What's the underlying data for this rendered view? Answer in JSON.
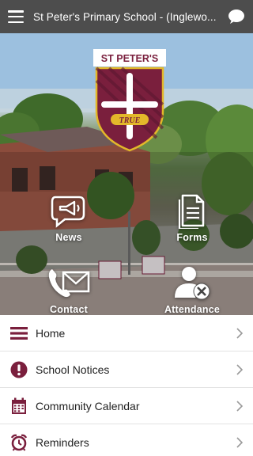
{
  "header": {
    "title": "St Peter's Primary School - (Inglewo...",
    "menu_icon": "hamburger-icon",
    "chat_icon": "chat-bubble-icon"
  },
  "crest": {
    "name": "ST PETER'S",
    "motto": "TRUE"
  },
  "tiles": [
    {
      "label": "News",
      "icon": "megaphone-icon"
    },
    {
      "label": "Forms",
      "icon": "document-icon"
    },
    {
      "label": "Contact",
      "icon": "phone-envelope-icon"
    },
    {
      "label": "Attendance",
      "icon": "person-cross-icon"
    }
  ],
  "menu": [
    {
      "label": "Home",
      "icon": "list-icon"
    },
    {
      "label": "School Notices",
      "icon": "alert-icon"
    },
    {
      "label": "Community Calendar",
      "icon": "calendar-icon"
    },
    {
      "label": "Reminders",
      "icon": "alarm-clock-icon"
    }
  ],
  "colors": {
    "header_bg": "#4d4d4d",
    "brand_maroon": "#7a1f3d",
    "crest_gold": "#e3b82a",
    "chevron": "#9a9a9a"
  }
}
